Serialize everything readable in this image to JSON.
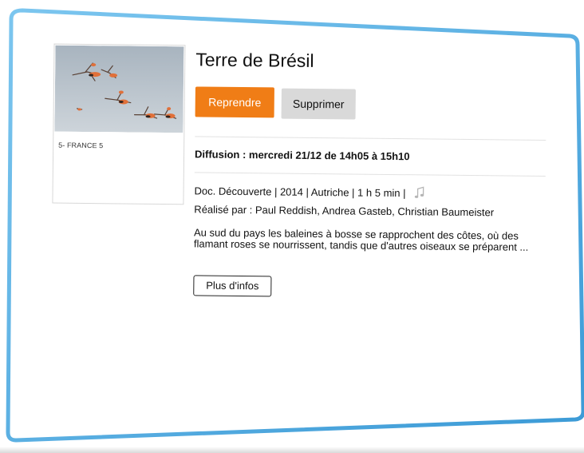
{
  "program": {
    "title": "Terre de Brésil",
    "channel": "5- FRANCE 5",
    "broadcast": "Diffusion : mercredi 21/12 de 14h05 à 15h10",
    "meta": "Doc. Découverte | 2014 | Autriche | 1 h 5 min |",
    "director": "Réalisé par : Paul Reddish, Andrea Gasteb, Christian Baumeister",
    "synopsis": "Au sud du pays les baleines à bosse se rapprochent des côtes, où des flamant roses se nourrissent, tandis que d'autres oiseaux se préparent ..."
  },
  "actions": {
    "resume_label": "Reprendre",
    "delete_label": "Supprimer",
    "more_label": "Plus d'infos"
  },
  "icons": {
    "audio": "music-note-icon"
  },
  "colors": {
    "accent": "#f07d16",
    "secondary_button": "#d9d9d9",
    "frame": "#4aa8e0"
  }
}
